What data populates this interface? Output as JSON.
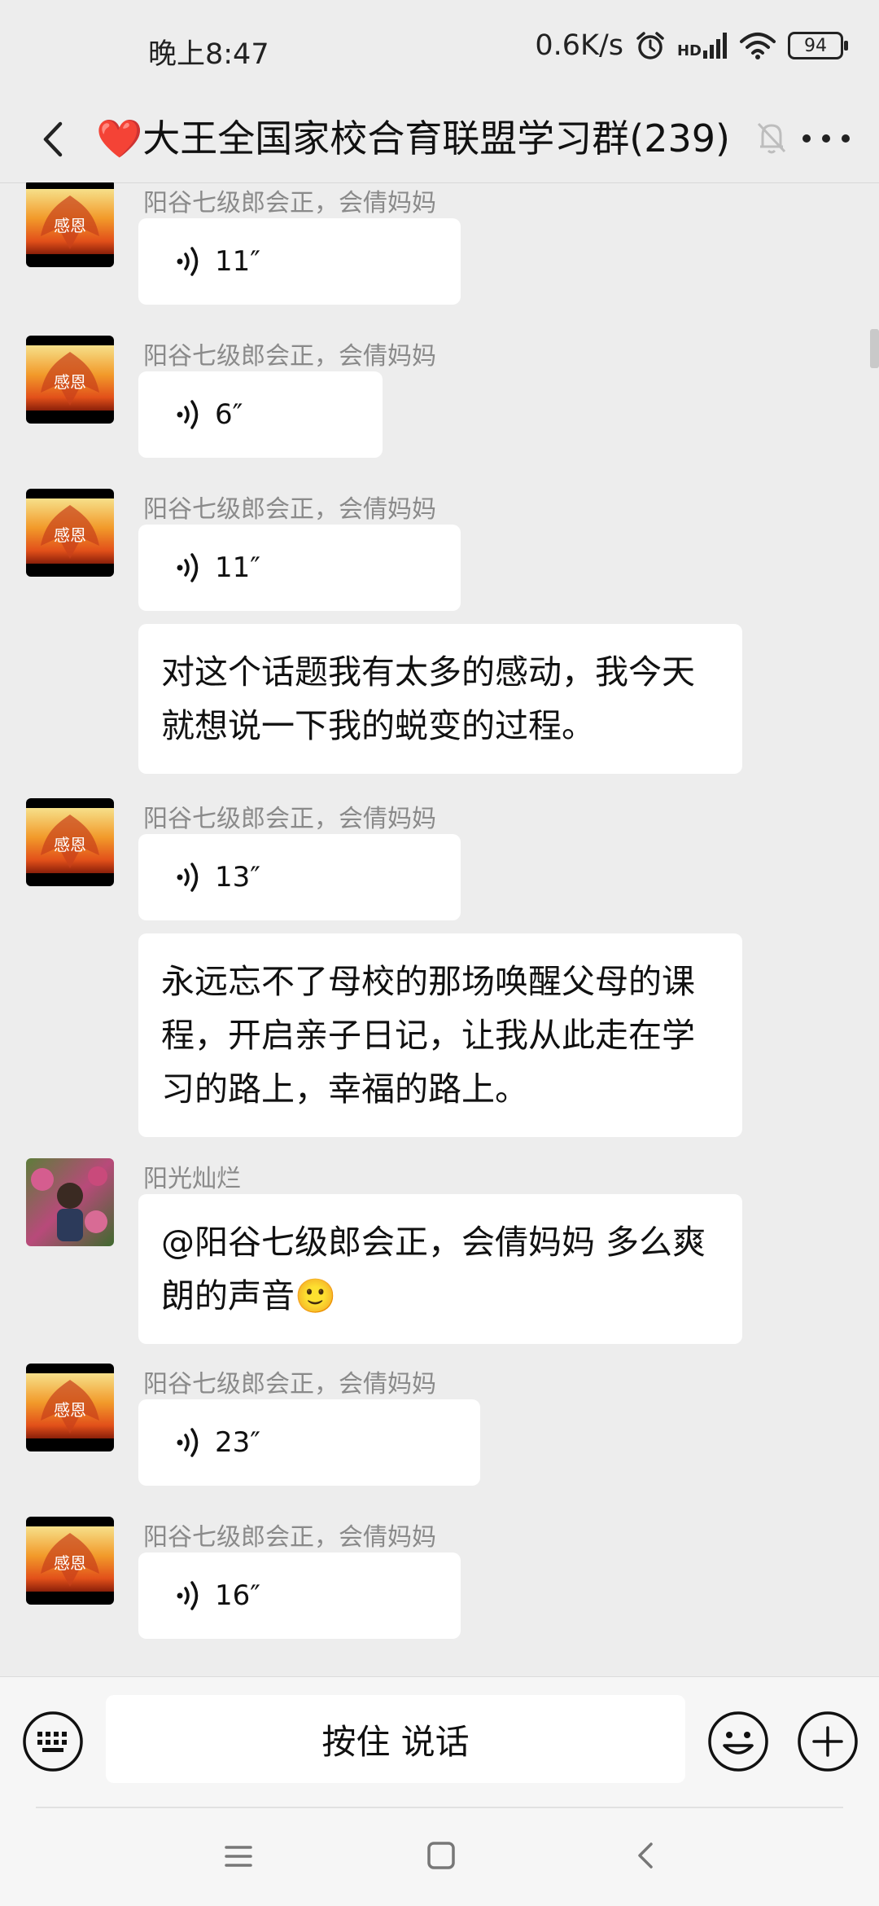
{
  "status_bar": {
    "time": "晚上8:47",
    "network_speed": "0.6K/s",
    "hd_label": "HD",
    "battery": "94"
  },
  "header": {
    "title_emoji": "❤️",
    "title": "大王全国家校合育联盟学习群(239)"
  },
  "messages": [
    {
      "sender": "阳谷七级郎会正，会倩妈妈",
      "duration": "11″"
    },
    {
      "sender": "阳谷七级郎会正，会倩妈妈",
      "duration": "6″"
    },
    {
      "sender": "阳谷七级郎会正，会倩妈妈",
      "duration": "11″"
    },
    {
      "text": "对这个话题我有太多的感动，我今天就想说一下我的蜕变的过程。"
    },
    {
      "sender": "阳谷七级郎会正，会倩妈妈",
      "duration": "13″"
    },
    {
      "text": "永远忘不了母校的那场唤醒父母的课程，开启亲子日记，让我从此走在学习的路上，幸福的路上。"
    },
    {
      "sender": "阳光灿烂",
      "text": "@阳谷七级郎会正，会倩妈妈   多么爽朗的声音🙂"
    },
    {
      "sender": "阳谷七级郎会正，会倩妈妈",
      "duration": "23″"
    },
    {
      "sender": "阳谷七级郎会正，会倩妈妈",
      "duration": "16″"
    }
  ],
  "input_bar": {
    "hold_to_talk": "按住 说话"
  },
  "colors": {
    "background": "#ededed",
    "bubble": "#ffffff",
    "sender_gray": "#8a8a8a",
    "heart": "#f0506e"
  }
}
